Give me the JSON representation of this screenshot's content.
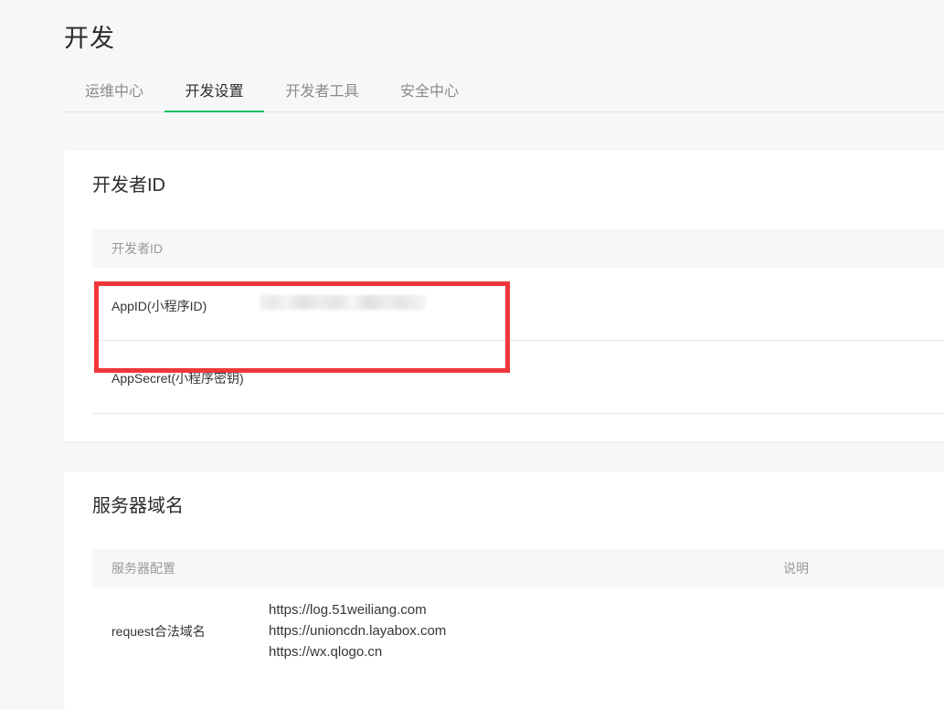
{
  "page": {
    "title": "开发"
  },
  "tabs": [
    {
      "label": "运维中心",
      "active": false
    },
    {
      "label": "开发设置",
      "active": true
    },
    {
      "label": "开发者工具",
      "active": false
    },
    {
      "label": "安全中心",
      "active": false
    }
  ],
  "developer_id": {
    "title": "开发者ID",
    "table_header": "开发者ID",
    "rows": [
      {
        "label": "AppID(小程序ID)",
        "value": ""
      },
      {
        "label": "AppSecret(小程序密钥)",
        "value": ""
      }
    ]
  },
  "server_domain": {
    "title": "服务器域名",
    "table_headers": {
      "config": "服务器配置",
      "description": "说明"
    },
    "rows": [
      {
        "label": "request合法域名",
        "domains": [
          "https://log.51weiliang.com",
          "https://unioncdn.layabox.com",
          "https://wx.qlogo.cn"
        ]
      }
    ]
  },
  "colors": {
    "accent_tab_underline": "#07c160",
    "highlight_box": "#f0373a",
    "background": "#f6f7f9"
  }
}
